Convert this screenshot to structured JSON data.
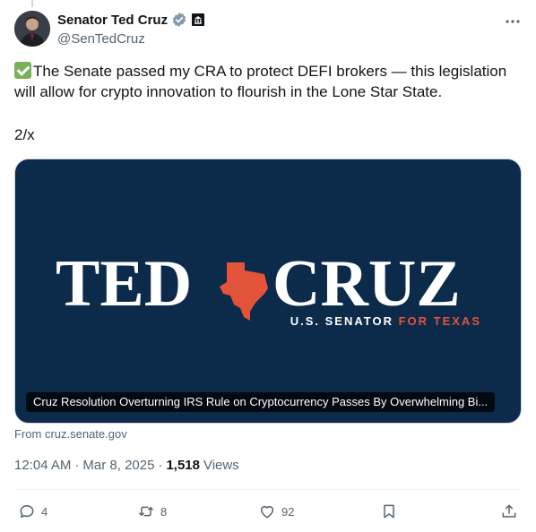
{
  "author": {
    "display_name": "Senator Ted Cruz",
    "handle": "@SenTedCruz",
    "verified_icon": "verified-badge-icon",
    "affiliation_icon": "government-building-icon"
  },
  "tweet": {
    "text": "The Senate passed my CRA to protect DEFI brokers — this legislation will allow for crypto innovation to flourish in the Lone Star State.",
    "thread_marker": "2/x"
  },
  "card": {
    "logo_left": "TED",
    "logo_right": "CRUZ",
    "logo_sub_prefix": "U.S. SENATOR ",
    "logo_sub_highlight": "FOR TEXAS",
    "caption": "Cruz Resolution Overturning IRS Rule on Cryptocurrency Passes By Overwhelming Bi...",
    "source": "From cruz.senate.gov",
    "background": "#0c2a4a",
    "accent": "#e2533a"
  },
  "meta": {
    "time": "12:04 AM",
    "date": "Mar 8, 2025",
    "views_count": "1,518",
    "views_label": "Views"
  },
  "actions": {
    "replies": "4",
    "reposts": "8",
    "likes": "92"
  }
}
